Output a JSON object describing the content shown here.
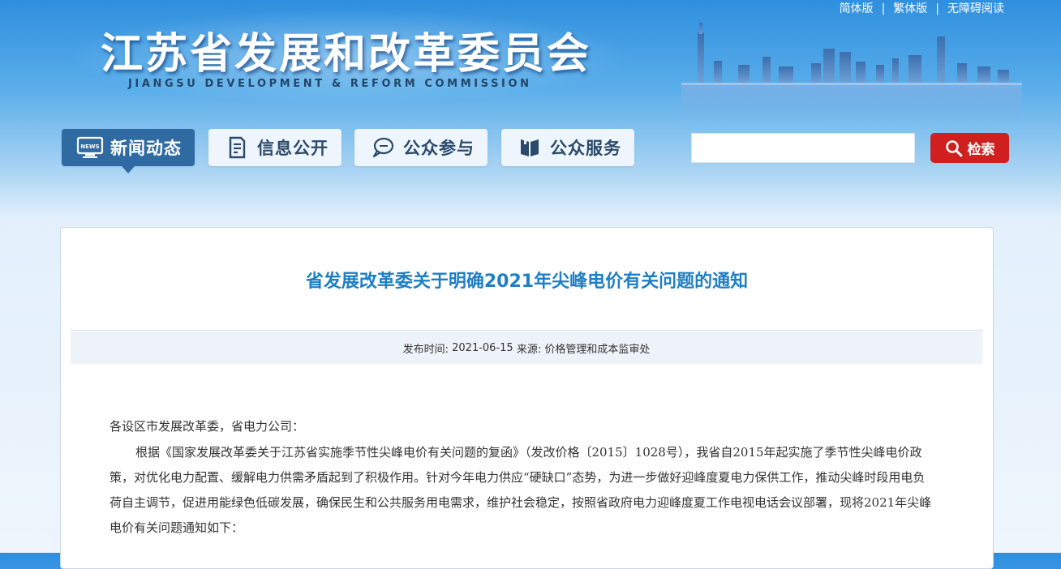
{
  "top_links": {
    "simplified": "简体版",
    "traditional": "繁体版",
    "accessible": "无障碍阅读",
    "separator": "|"
  },
  "site": {
    "title": "江苏省发展和改革委员会",
    "subtitle": "JIANGSU DEVELOPMENT & REFORM COMMISSION"
  },
  "nav": {
    "items": [
      {
        "label": "新闻动态",
        "icon": "news-monitor-icon",
        "active": true
      },
      {
        "label": "信息公开",
        "icon": "document-icon",
        "active": false
      },
      {
        "label": "公众参与",
        "icon": "chat-bubble-icon",
        "active": false
      },
      {
        "label": "公众服务",
        "icon": "book-icon",
        "active": false
      }
    ],
    "news_icon_text": "NEWS"
  },
  "search": {
    "placeholder": "",
    "button_label": "检索",
    "icon": "search-icon"
  },
  "article": {
    "title": "省发展改革委关于明确2021年尖峰电价有关问题的通知",
    "meta": {
      "date_label": "发布时间:",
      "date": "2021-06-15",
      "source_label": "来源:",
      "source": "价格管理和成本监审处"
    },
    "salutation": "各设区市发展改革委，省电力公司：",
    "paragraph": "根据《国家发展改革委关于江苏省实施季节性尖峰电价有关问题的复函》（发改价格〔2015〕1028号），我省自2015年起实施了季节性尖峰电价政策，对优化电力配置、缓解电力供需矛盾起到了积极作用。针对今年电力供应“硬缺口”态势，为进一步做好迎峰度夏电力保供工作，推动尖峰时段用电负荷自主调节，促进用能绿色低碳发展，确保民生和公共服务用电需求，维护社会稳定，按照省政府电力迎峰度夏工作电视电话会议部署，现将2021年尖峰电价有关问题通知如下："
  },
  "colors": {
    "nav_active": "#2f6aa3",
    "title_blue": "#1d7fc5",
    "search_red": "#d01f1f"
  }
}
